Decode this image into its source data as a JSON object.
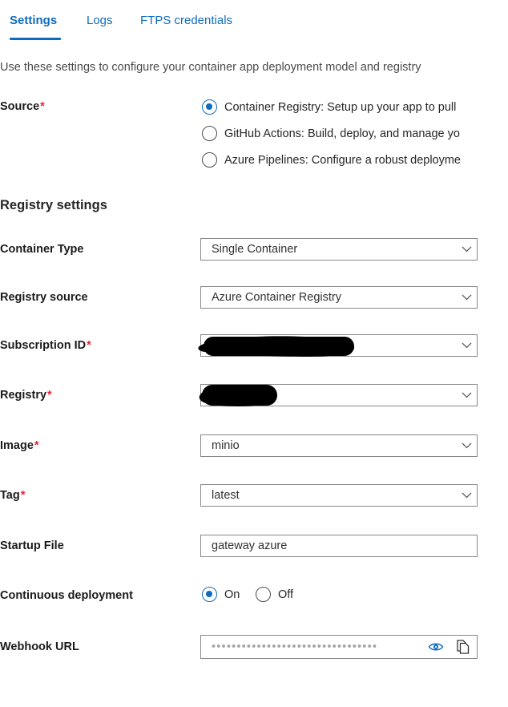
{
  "tabs": [
    {
      "label": "Settings",
      "active": true
    },
    {
      "label": "Logs",
      "active": false
    },
    {
      "label": "FTPS credentials",
      "active": false
    }
  ],
  "description": "Use these settings to configure your container app deployment model and registry",
  "source": {
    "label": "Source",
    "required": "*",
    "options": [
      {
        "label": "Container Registry: Setup up your app to pull",
        "selected": true
      },
      {
        "label": "GitHub Actions: Build, deploy, and manage yo",
        "selected": false
      },
      {
        "label": "Azure Pipelines: Configure a robust deployme",
        "selected": false
      }
    ]
  },
  "registry_settings": {
    "heading": "Registry settings",
    "fields": [
      {
        "label": "Container Type",
        "required": "",
        "value": "Single Container",
        "control": "dropdown",
        "redacted": false
      },
      {
        "label": "Registry source",
        "required": "",
        "value": "Azure Container Registry",
        "control": "dropdown",
        "redacted": false
      },
      {
        "label": "Subscription ID",
        "required": "*",
        "value": "",
        "control": "dropdown",
        "redacted": true
      },
      {
        "label": "Registry",
        "required": "*",
        "value": "",
        "control": "dropdown",
        "redacted": true
      },
      {
        "label": "Image",
        "required": "*",
        "value": "minio",
        "control": "dropdown",
        "redacted": false
      },
      {
        "label": "Tag",
        "required": "*",
        "value": "latest",
        "control": "dropdown",
        "redacted": false
      },
      {
        "label": "Startup File",
        "required": "",
        "value": "gateway azure",
        "control": "text",
        "redacted": false
      }
    ]
  },
  "continuous_deployment": {
    "label": "Continuous deployment",
    "options": [
      {
        "label": "On",
        "selected": true
      },
      {
        "label": "Off",
        "selected": false
      }
    ]
  },
  "webhook": {
    "label": "Webhook URL",
    "masked_value": "•••••••••••••••••••••••••••••••••",
    "ellipsis": "...",
    "reveal_icon": "eye-icon",
    "copy_icon": "copy-icon"
  },
  "colors": {
    "accent": "#0f6cbd",
    "required_asterisk": "#e3253a",
    "label_text": "#1b1b1b",
    "field_border": "#8a8886",
    "redaction": "#000000"
  }
}
